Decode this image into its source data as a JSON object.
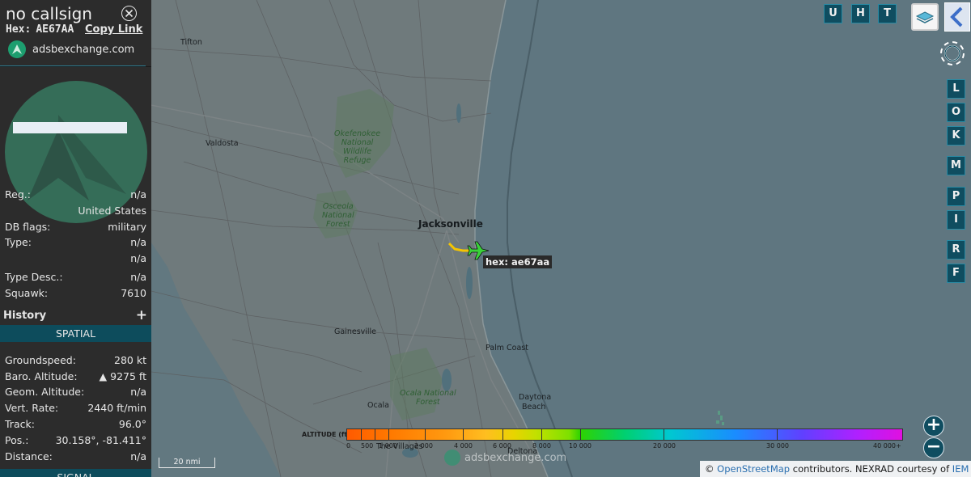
{
  "sidebar": {
    "callsign": "no callsign",
    "hex_label": "Hex:",
    "hex_value": "AE67AA",
    "copy_link": "Copy Link",
    "brand": "adsbexchange.com",
    "details": [
      {
        "key": "Reg.:",
        "value": "n/a"
      },
      {
        "key": "",
        "value": "United States"
      },
      {
        "key": "DB flags:",
        "value": "military"
      },
      {
        "key": "Type:",
        "value": "n/a"
      },
      {
        "key": "",
        "value": "n/a"
      },
      {
        "key": "Type Desc.:",
        "value": "n/a"
      },
      {
        "key": "Squawk:",
        "value": "7610"
      }
    ],
    "history_title": "History",
    "history_plus": "+",
    "spatial_title": "SPATIAL",
    "spatial": [
      {
        "key": "Groundspeed:",
        "value": "280 kt"
      },
      {
        "key": "Baro. Altitude:",
        "value": "▲ 9275 ft"
      },
      {
        "key": "Geom. Altitude:",
        "value": "n/a"
      },
      {
        "key": "Vert. Rate:",
        "value": "2440 ft/min"
      },
      {
        "key": "Track:",
        "value": "96.0°"
      },
      {
        "key": "Pos.:",
        "value": "30.158°, -81.411°"
      },
      {
        "key": "Distance:",
        "value": "n/a"
      }
    ],
    "signal_title": "SIGNAL"
  },
  "map": {
    "places": {
      "tifton": "Tifton",
      "valdosta": "Valdosta",
      "jacksonville": "Jacksonville",
      "gainesville": "Gainesville",
      "palm_coast": "Palm Coast",
      "ocala": "Ocala",
      "daytona_1": "Daytona",
      "daytona_2": "Beach",
      "deltona": "Deltona",
      "villages": "The Villages"
    },
    "forests": {
      "okefenokee": [
        "Okefenokee",
        "National",
        "Wildlife",
        "Refuge"
      ],
      "osceola": [
        "Osceola",
        "National",
        "Forest"
      ],
      "ocala": [
        "Ocala National",
        "Forest"
      ]
    },
    "aircraft_label": "hex: ae67aa",
    "scale": "20 nmi",
    "watermark": "adsbexchange.com",
    "attribution": {
      "prefix": "©",
      "osm": "OpenStreetMap",
      "middle": "contributors. NEXRAD courtesy of",
      "iem": "IEM"
    },
    "zoom_in": "+",
    "zoom_out": "−"
  },
  "toolbar": {
    "top_buttons": [
      "U",
      "H",
      "T"
    ],
    "side_buttons": [
      "L",
      "O",
      "K",
      "M",
      "P",
      "I",
      "R",
      "F"
    ]
  },
  "altitude_legend": {
    "title": "ALTITUDE (ft)",
    "ticks": [
      "0",
      "500",
      "1 000",
      "2 000",
      "4 000",
      "6 000",
      "8 000",
      "10 000",
      "20 000",
      "30 000",
      "40 000+"
    ]
  },
  "colors": {
    "panel_bg": "#2c2c2c",
    "section_bar": "#0d4c5c",
    "button_bg": "#0f4d60",
    "aircraft": "#3ad13a",
    "track": "#f5c400",
    "ocean": "#5f7680",
    "land": "#6f7a7c"
  }
}
